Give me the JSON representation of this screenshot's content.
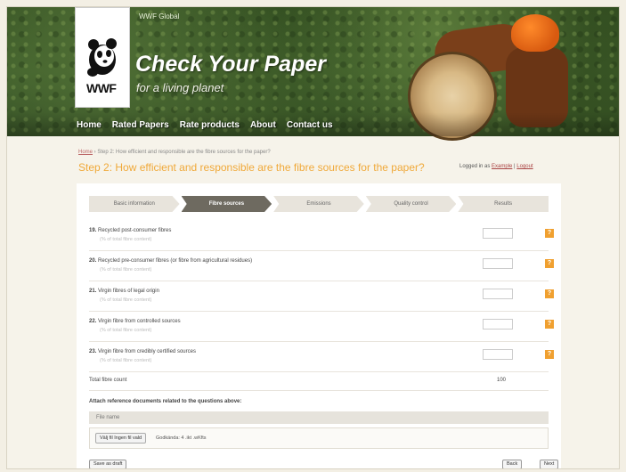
{
  "header": {
    "site_tag": "WWF Global",
    "title": "Check Your Paper",
    "subtitle": "for a living planet",
    "logo_text": "WWF"
  },
  "nav": [
    "Home",
    "Rated Papers",
    "Rate products",
    "About",
    "Contact us"
  ],
  "breadcrumb": {
    "home": "Home",
    "rest": " › Step 2: How efficient and responsible are the fibre sources for the paper?"
  },
  "page_title": "Step 2: How efficient and responsible are the fibre sources for the paper?",
  "login": {
    "prefix": "Logged in as ",
    "user": "Example",
    "sep": " | ",
    "logout": "Logout"
  },
  "steps": [
    {
      "label": "Basic information",
      "active": false
    },
    {
      "label": "Fibre sources",
      "active": true
    },
    {
      "label": "Emissions",
      "active": false
    },
    {
      "label": "Quality control",
      "active": false
    },
    {
      "label": "Results",
      "active": false
    }
  ],
  "questions": [
    {
      "num": "19.",
      "text": "Recycled post-consumer fibres",
      "hint": "(% of total fibre content)",
      "value": ""
    },
    {
      "num": "20.",
      "text": "Recycled pre-consumer fibres (or fibre from agricultural residues)",
      "hint": "(% of total fibre content)",
      "value": ""
    },
    {
      "num": "21.",
      "text": "Virgin fibres of legal origin",
      "hint": "(% of total fibre content)",
      "value": ""
    },
    {
      "num": "22.",
      "text": "Virgin fibre from controlled sources",
      "hint": "(% of total fibre content)",
      "value": ""
    },
    {
      "num": "23.",
      "text": "Virgin fibre from credibly certified sources",
      "hint": "(% of total fibre content)",
      "value": ""
    }
  ],
  "help_label": "?",
  "total": {
    "label": "Total fibre count",
    "value": "100"
  },
  "attach": {
    "title": "Attach reference documents related to the questions above:",
    "file_header": "File name",
    "file_button": "Välj fil  Ingen fil vald",
    "file_note": "Godkända: 4 .ikt .wKfts"
  },
  "buttons": {
    "save": "Save as draft",
    "back": "Back",
    "next": "Next"
  }
}
